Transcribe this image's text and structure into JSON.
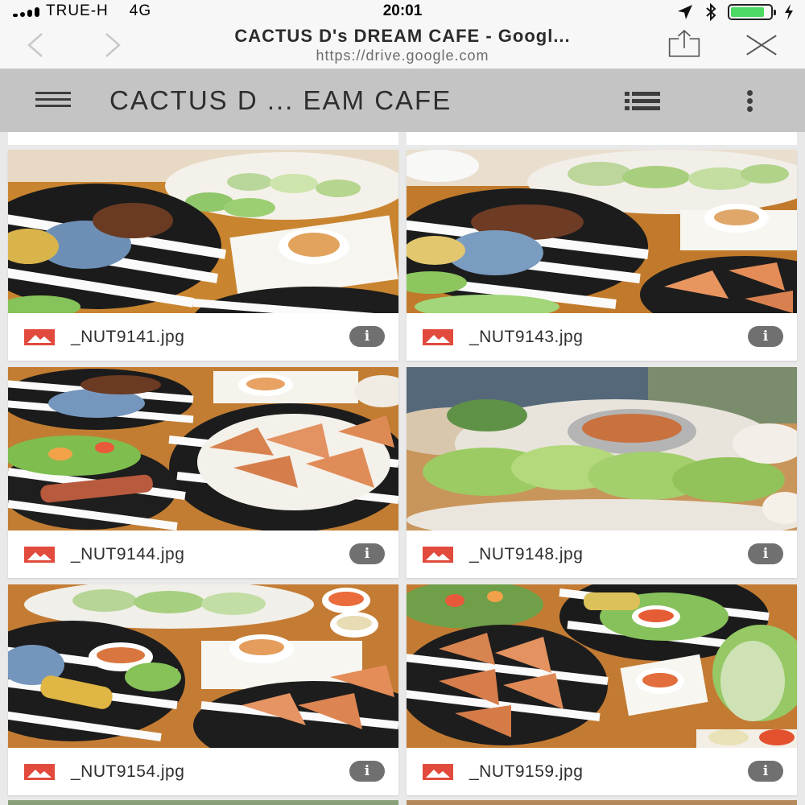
{
  "status_bar": {
    "carrier": "TRUE-H",
    "network": "4G",
    "time": "20:01",
    "battery_level": 0.85,
    "icons": [
      "signal-icon",
      "location-arrow-icon",
      "bluetooth-icon",
      "battery-icon",
      "charging-bolt-icon"
    ]
  },
  "browser": {
    "title": "CACTUS D's DREAM CAFE - Googl...",
    "url": "https://drive.google.com",
    "icons": [
      "back-arrow-icon",
      "forward-arrow-icon",
      "share-icon",
      "close-icon"
    ]
  },
  "app_bar": {
    "folder_title": "CACTUS D ... EAM CAFE",
    "icons": [
      "hamburger-menu-icon",
      "list-view-icon",
      "more-vert-icon"
    ]
  },
  "colors": {
    "image_icon_red": "#e14a3c",
    "app_bar_bg": "#c4c4c4",
    "info_button": "#707070",
    "battery_green": "#4cd964"
  },
  "files": [
    {
      "name": "_NUT9141.jpg",
      "icon": "image-file-icon",
      "info_label": "i"
    },
    {
      "name": "_NUT9143.jpg",
      "icon": "image-file-icon",
      "info_label": "i"
    },
    {
      "name": "_NUT9144.jpg",
      "icon": "image-file-icon",
      "info_label": "i"
    },
    {
      "name": "_NUT9148.jpg",
      "icon": "image-file-icon",
      "info_label": "i"
    },
    {
      "name": "_NUT9154.jpg",
      "icon": "image-file-icon",
      "info_label": "i"
    },
    {
      "name": "_NUT9159.jpg",
      "icon": "image-file-icon",
      "info_label": "i"
    }
  ]
}
